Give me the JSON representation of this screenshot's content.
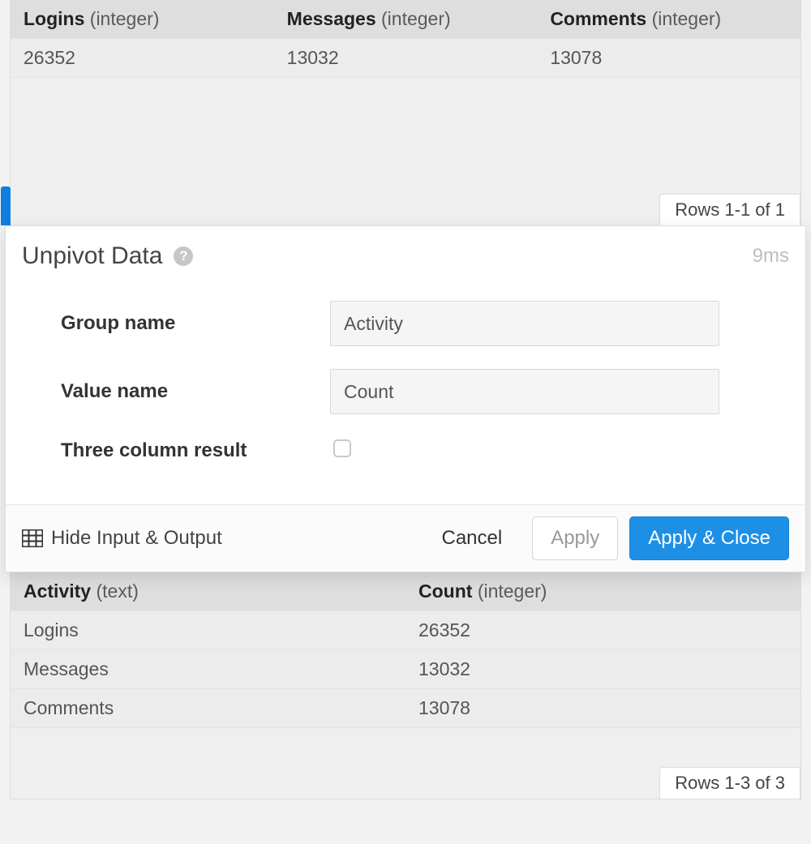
{
  "input_table": {
    "columns": [
      {
        "name": "Logins",
        "type": "(integer)"
      },
      {
        "name": "Messages",
        "type": "(integer)"
      },
      {
        "name": "Comments",
        "type": "(integer)"
      }
    ],
    "rows": [
      {
        "c0": "26352",
        "c1": "13032",
        "c2": "13078"
      }
    ],
    "row_counter": "Rows 1-1 of 1"
  },
  "dialog": {
    "title": "Unpivot Data",
    "timing": "9ms",
    "fields": {
      "group_name_label": "Group name",
      "group_name_value": "Activity",
      "value_name_label": "Value name",
      "value_name_value": "Count",
      "three_col_label": "Three column result",
      "three_col_checked": false
    },
    "footer": {
      "hide_io": "Hide Input & Output",
      "cancel": "Cancel",
      "apply": "Apply",
      "apply_close": "Apply & Close"
    }
  },
  "output_table": {
    "columns": [
      {
        "name": "Activity",
        "type": "(text)"
      },
      {
        "name": "Count",
        "type": "(integer)"
      }
    ],
    "rows": [
      {
        "c0": "Logins",
        "c1": "26352"
      },
      {
        "c0": "Messages",
        "c1": "13032"
      },
      {
        "c0": "Comments",
        "c1": "13078"
      }
    ],
    "row_counter": "Rows 1-3 of 3"
  }
}
